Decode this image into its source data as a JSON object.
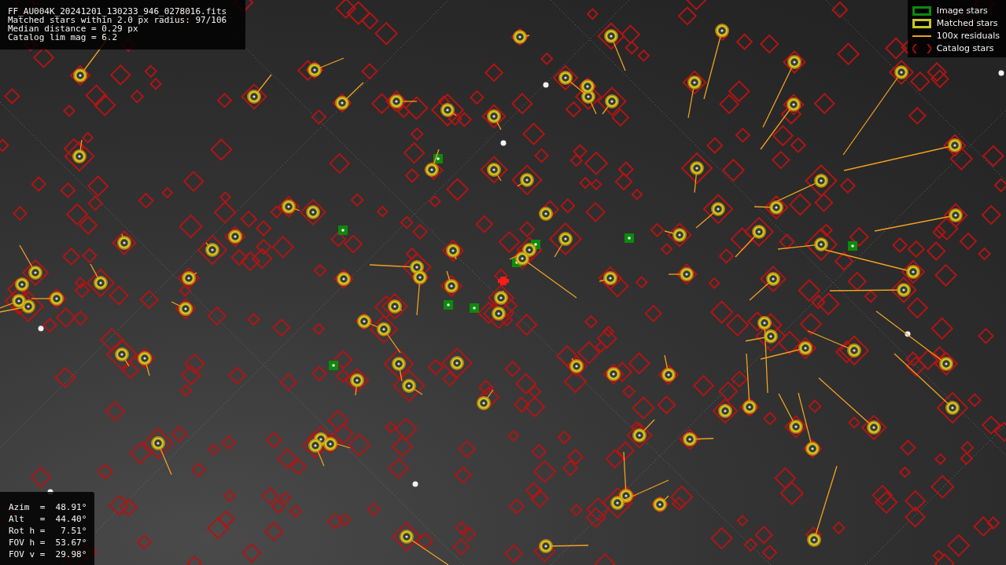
{
  "header_info": {
    "lines": [
      "FF_AU004K_20241201_130233_946_0278016.fits",
      "Matched stars within 2.0 px radius: 97/106",
      "Median distance = 0.29 px",
      "Catalog lim mag = 6.2"
    ]
  },
  "legend": [
    {
      "kind": "box",
      "color": "#0c8a0c",
      "label": "Image stars"
    },
    {
      "kind": "box",
      "color": "#c8c81a",
      "label": "Matched stars"
    },
    {
      "kind": "line",
      "color": "#f0a020",
      "label": "100x residuals"
    },
    {
      "kind": "diamond",
      "color": "#a01010",
      "label": "Catalog stars"
    }
  ],
  "pointing_info": {
    "lines": [
      "Azim  =  48.91°",
      "Alt   =  44.40°",
      "Rot h =   7.51°",
      "FOV h =  53.67°",
      "FOV v =  29.98°"
    ]
  }
}
